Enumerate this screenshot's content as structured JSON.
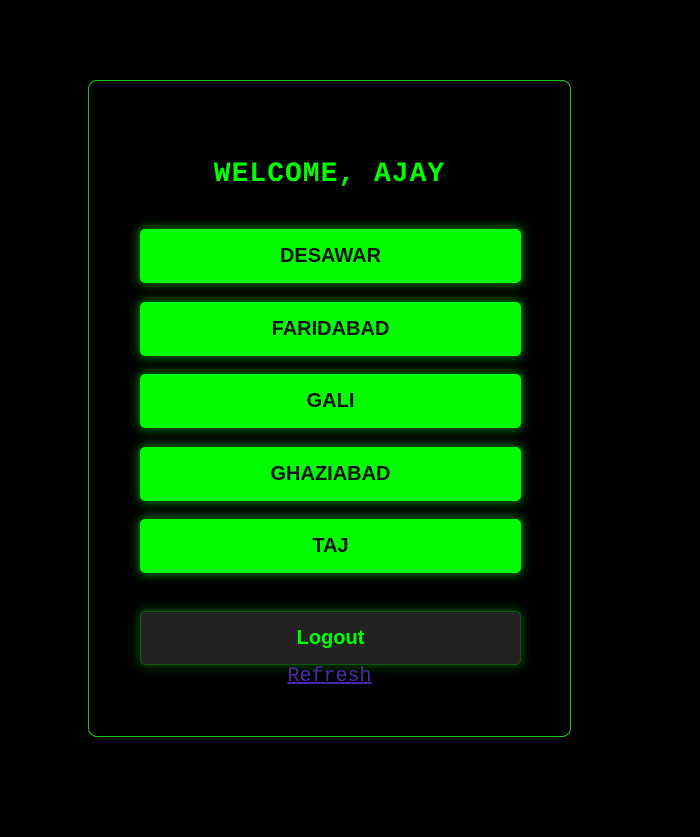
{
  "welcome_text": "WELCOME, AJAY",
  "games": [
    {
      "label": "DESAWAR"
    },
    {
      "label": "FARIDABAD"
    },
    {
      "label": "GALI"
    },
    {
      "label": "GHAZIABAD"
    },
    {
      "label": "TAJ"
    }
  ],
  "logout_label": "Logout",
  "refresh_label": "Refresh",
  "colors": {
    "background": "#000000",
    "accent": "#00ff00",
    "card_border": "#22c322",
    "logout_bg": "#222222",
    "link": "#4b2aa8"
  }
}
